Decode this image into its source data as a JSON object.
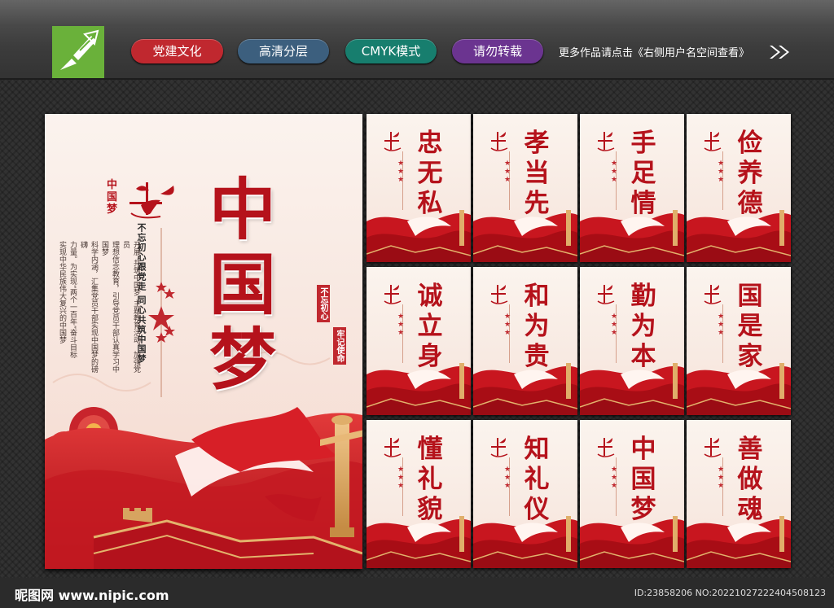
{
  "header": {
    "tags": [
      "党建文化",
      "高清分层",
      "CMYK模式",
      "请勿转载"
    ],
    "note": "更多作品请点击《右侧用户名空间查看》"
  },
  "poster": {
    "title_lines": [
      "中",
      "国",
      "梦"
    ],
    "slogan": "不忘初心跟党走 同心共筑中国梦",
    "body_lines": [
      "实现中华民族伟大复兴的中国梦",
      "力量。为实现“两个一百年”奋斗目标",
      "科学内涵，汇集党员干部实现中国梦的磅礴",
      "理想信念教育，引导党员干部认真学习中国梦",
      "开展“共筑中国梦”主题教育活动，加强党员"
    ],
    "side_left": "不忘初心",
    "side_right": "牢记使命",
    "logo_text": "中国梦"
  },
  "cards": [
    "忠无私",
    "孝当先",
    "手足情",
    "俭养德",
    "诚立身",
    "和为贵",
    "勤为本",
    "国是家",
    "懂礼貌",
    "知礼仪",
    "中国梦",
    "善做魂"
  ],
  "footer": {
    "site": "昵图网 www.nipic.com",
    "id": "ID:23858206 NO:20221027222404508123"
  },
  "colors": {
    "accent": "#b5121b",
    "poster_bg": "#f8e6de"
  }
}
